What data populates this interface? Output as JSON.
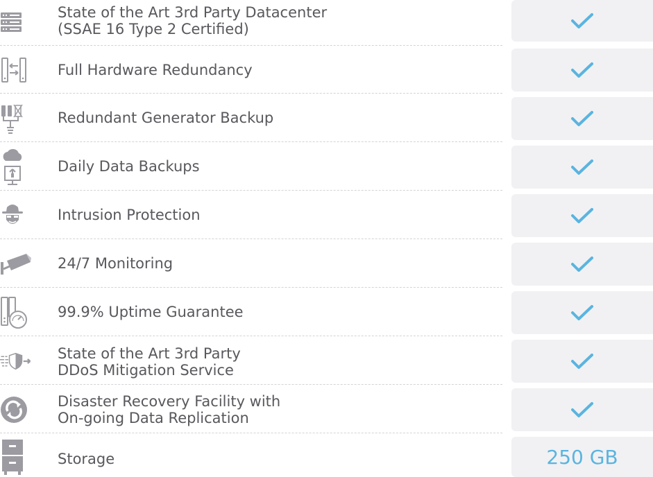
{
  "features": [
    {
      "icon": "server-rack-icon",
      "line1": "State of the Art 3rd Party Datacenter",
      "line2": "(SSAE 16 Type 2 Certified)",
      "value_icon": "checkmark-icon"
    },
    {
      "icon": "redundant-servers-icon",
      "line1": "Full Hardware Redundancy",
      "line2": "",
      "value_icon": "checkmark-icon"
    },
    {
      "icon": "generator-icon",
      "line1": "Redundant Generator Backup",
      "line2": "",
      "value_icon": "checkmark-icon"
    },
    {
      "icon": "cloud-upload-icon",
      "line1": "Daily Data Backups",
      "line2": "",
      "value_icon": "checkmark-icon"
    },
    {
      "icon": "intruder-icon",
      "line1": "Intrusion Protection",
      "line2": "",
      "value_icon": "checkmark-icon"
    },
    {
      "icon": "security-camera-icon",
      "line1": "24/7 Monitoring",
      "line2": "",
      "value_icon": "checkmark-icon"
    },
    {
      "icon": "uptime-gauge-icon",
      "line1": "99.9% Uptime Guarantee",
      "line2": "",
      "value_icon": "checkmark-icon"
    },
    {
      "icon": "ddos-shield-icon",
      "line1": "State of the Art 3rd Party",
      "line2": "DDoS Mitigation Service",
      "value_icon": "checkmark-icon"
    },
    {
      "icon": "recovery-sync-icon",
      "line1": "Disaster Recovery Facility with",
      "line2": "On-going Data Replication",
      "value_icon": "checkmark-icon"
    },
    {
      "icon": "storage-cabinet-icon",
      "line1": "Storage",
      "line2": "",
      "value_text": "250 GB"
    }
  ],
  "colors": {
    "icon_gray": "#9b9ba1",
    "text": "#58585d",
    "check": "#5ab4e0",
    "cell_bg": "#f1f1f3",
    "divider": "#d3d3d7"
  }
}
